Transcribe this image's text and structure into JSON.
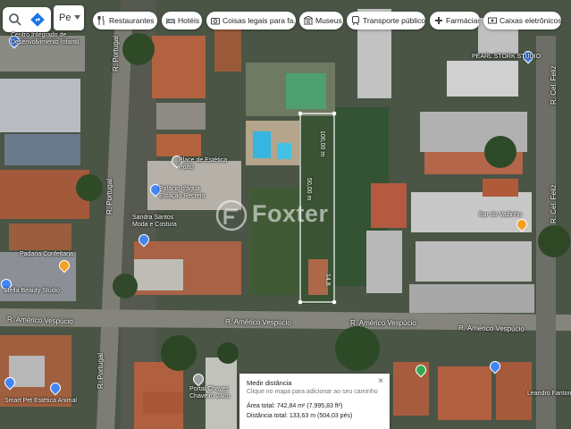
{
  "toolbar": {
    "mode_label": "Pe",
    "chips": [
      {
        "name": "restaurants",
        "label": "Restaurantes",
        "icon": "restaurant-icon"
      },
      {
        "name": "hotels",
        "label": "Hotéis",
        "icon": "hotel-icon"
      },
      {
        "name": "things-to-do",
        "label": "Coisas legais para fa...",
        "icon": "camera-icon"
      },
      {
        "name": "museums",
        "label": "Museus",
        "icon": "museum-icon"
      },
      {
        "name": "transit",
        "label": "Transporte público",
        "icon": "train-icon"
      },
      {
        "name": "pharmacies",
        "label": "Farmácias",
        "icon": "pharmacy-icon"
      },
      {
        "name": "electronics",
        "label": "Caixas eletrônicos",
        "icon": "atm-icon"
      }
    ]
  },
  "streets": {
    "portugal_top": "R. Portugal",
    "portugal_mid": "R. Portugal",
    "portugal_bottom": "R. Portugal",
    "americo_left": "R. Américo Vespúcio",
    "americo_mid": "R. Américo Vespúcio",
    "americo_center": "R. Américo Vespúcio",
    "americo_right": "R. Américo Vespúcio",
    "felix_top": "R. Cel. Feliz",
    "felix_mid": "R. Cel. Feliz"
  },
  "places": {
    "colegio": "Centro Integrado de\nDesenvolvimento Infantil",
    "studio": "PEARL STORK STUDIO",
    "estetica": "Place de Estética\nPorto",
    "palacio": "Palácio d'água\nEstação Recreio",
    "sandra": "Sandra Santos\nModa e Costura",
    "padaria": "Padaria Confeitaria",
    "stella": "Stella Beauty Studio",
    "bar": "Bar do Vadinho",
    "portal": "Portal Chaves\nChaveiro 24hs",
    "smart": "Smart Pet Estética Animal",
    "leandro": "Leandro Fantoni Spa"
  },
  "measurements": {
    "length": "100,00 m",
    "width": "50,00 m",
    "bottom_width": "14,8"
  },
  "watermark": "Foxter",
  "distance_panel": {
    "title": "Medir distância",
    "subtitle": "Clique no mapa para adicionar ao seu caminho",
    "area": "Área total: 742,84 m² (7.995,83 ft²)",
    "distance": "Distância total: 133,63 m (504,03 pés)",
    "close": "×"
  },
  "colors": {
    "accent": "#1a73e8",
    "measure_outline": "#ffffff",
    "pin_red": "#ea4335",
    "pin_orange": "#f4a020",
    "pin_blue": "#4285f4"
  }
}
